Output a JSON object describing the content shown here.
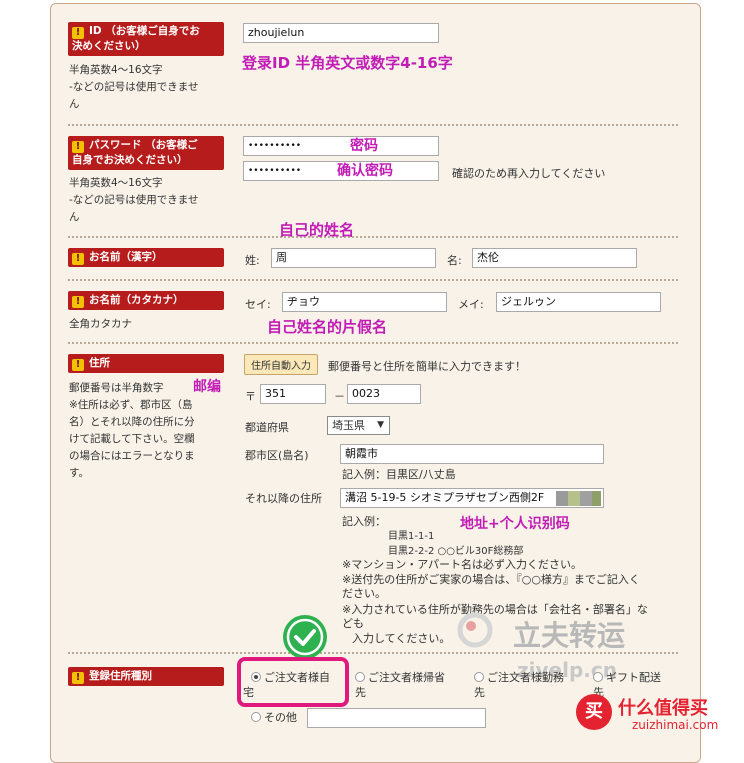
{
  "sections": {
    "id": {
      "label": "ID （お客様ご自身でお決めください）",
      "label_line1": "ID （お客様ご自身でお",
      "label_line2": "決めください）",
      "note_line1": "半角英数4～16文字",
      "note_line2": "-などの記号は使用できませ",
      "note_line3": "ん",
      "value": "zhoujielun",
      "annotation": "登录ID 半角英文或数字4-16字"
    },
    "password": {
      "label_line1": "パスワード （お客様ご",
      "label_line2": "自身でお決めください）",
      "note_line1": "半角英数4～16文字",
      "note_line2": "-などの記号は使用できませ",
      "note_line3": "ん",
      "value": "••••••••••",
      "confirm_value": "••••••••••",
      "confirm_hint": "確認のため再入力してください",
      "annotation_pw": "密码",
      "annotation_confirm": "确认密码"
    },
    "name_kanji": {
      "label": "お名前（漢字）",
      "annotation": "自己的姓名",
      "last_label": "姓:",
      "last_value": "周",
      "first_label": "名:",
      "first_value": "杰伦"
    },
    "name_kana": {
      "label": "お名前（カタカナ）",
      "note": "全角カタカナ",
      "last_label": "セイ:",
      "last_value": "ヂョウ",
      "first_label": "メイ:",
      "first_value": "ジェルゥン",
      "annotation": "自己姓名的片假名"
    },
    "address": {
      "label": "住所",
      "note_line1": "郵便番号は半角数字",
      "note_line2": "※住所は必ず、郡市区（島",
      "note_line3": "名）とそれ以降の住所に分",
      "note_line4": "けて記載して下さい。空欄",
      "note_line5": "の場合にはエラーとなりま",
      "note_line6": "す。",
      "annotation_zip": "邮编",
      "auto_button": "住所自動入力",
      "auto_hint": "郵便番号と住所を簡単に入力できます！",
      "zip_mark": "〒",
      "zip1": "351",
      "zip_dash": "－",
      "zip2": "0023",
      "pref_label": "都道府県",
      "pref_value": "埼玉県",
      "city_label": "郡市区(島名)",
      "city_value": "朝霞市",
      "city_example": "記入例：目黒区/八丈島",
      "rest_label": "それ以降の住所",
      "rest_value": "溝沼 5-19-5 シオミプラザセブン西側2F",
      "rest_example": "記入例：",
      "rest_example_1": "目黒1-1-1",
      "rest_example_2": "目黒2-2-2 ○○ビル30F総務部",
      "annotation_addr": "地址+个人识别码",
      "notice_1": "※マンション・アパート名は必ず入力ください。",
      "notice_2": "※送付先の住所がご実家の場合は、『○○様方』までご記入く",
      "notice_3": "ださい。",
      "notice_4": "※入力されている住所が勤務先の場合は「会社名・部署名」な",
      "notice_5": "ども",
      "notice_6": "入力してください。"
    },
    "address_type": {
      "label": "登録住所種別",
      "options": [
        {
          "line1": "ご注文者様自",
          "line2": "宅"
        },
        {
          "line1": "ご注文者様帰省",
          "line2": "先"
        },
        {
          "line1": "ご注文者様勤務",
          "line2": "先"
        },
        {
          "line1": "ギフト配送",
          "line2": "先"
        },
        {
          "line1": "その他",
          "line2": ""
        }
      ]
    }
  },
  "watermark": {
    "text1": "立夫转运",
    "text1_sub": "zivelp.cn",
    "text2": "什么值得买",
    "text2_sub": "zuizhimai.com",
    "logo": "买"
  },
  "colors": {
    "label_bg": "#b71c1c",
    "annotation": "#c21cb6",
    "highlight": "#e0197d",
    "check": "#2fb150"
  }
}
